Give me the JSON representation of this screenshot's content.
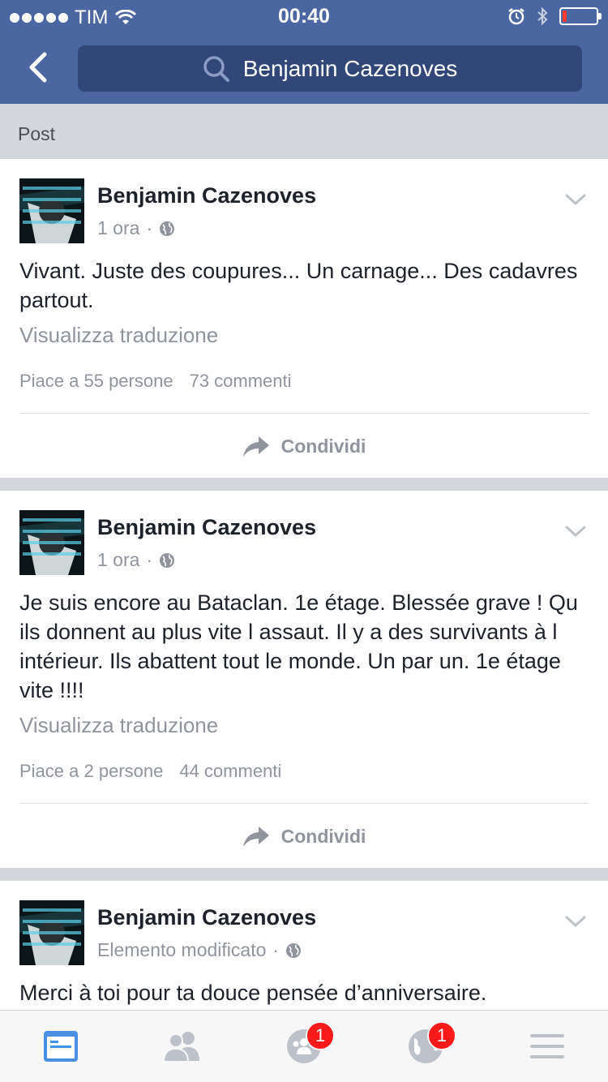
{
  "status_bar": {
    "carrier": "TIM",
    "time": "00:40",
    "signal_dots": 5,
    "battery_level": 0.08
  },
  "nav": {
    "search_text": "Benjamin Cazenoves"
  },
  "section": {
    "title": "Post"
  },
  "posts": [
    {
      "author": "Benjamin Cazenoves",
      "time": "1 ora",
      "text": "Vivant. Juste des coupures... Un carnage... Des cadavres partout.",
      "translate": "Visualizza traduzione",
      "likes": "Piace a 55 persone",
      "comments": "73 commenti",
      "share": "Condividi"
    },
    {
      "author": "Benjamin Cazenoves",
      "time": "1 ora",
      "text": "Je suis encore au Bataclan. 1e étage. Blessée grave ! Qu ils donnent au plus vite l assaut. Il y a des survivants à l intérieur. Ils abattent tout le monde. Un par un. 1e étage vite !!!!",
      "translate": "Visualizza traduzione",
      "likes": "Piace a 2 persone",
      "comments": "44 commenti",
      "share": "Condividi"
    },
    {
      "author": "Benjamin Cazenoves",
      "time": "Elemento modificato",
      "text": "Merci à toi pour ta douce pensée d’anniversaire."
    }
  ],
  "tabbar": {
    "groups_badge": "1",
    "notifications_badge": "1",
    "active_color": "#4a90e2",
    "inactive_color": "#bdc1c9"
  }
}
